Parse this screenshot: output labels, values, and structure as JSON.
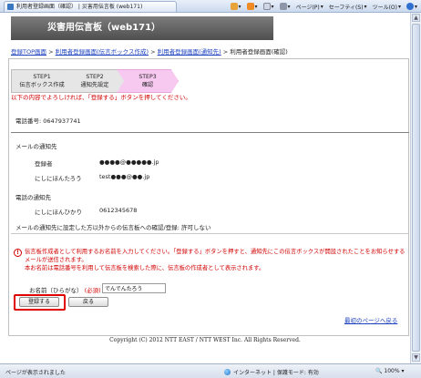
{
  "browser": {
    "tab_title": "利用者登録画面（確認） | 災害用伝言板 (web171)",
    "toolbar": [
      "ページ(P)",
      "セーフティ(S)",
      "ツール(O)"
    ],
    "status_text": "ページが表示されました",
    "zone_text": "インターネット | 保護モード: 有効",
    "zoom": "100%"
  },
  "page": {
    "banner_title": "災害用伝言板（web171）",
    "breadcrumb": [
      {
        "label": "登録TOP画面"
      },
      {
        "label": "利用者登録画面(伝言ボックス作成)"
      },
      {
        "label": "利用者登録画面(通知先)"
      },
      {
        "label": "利用者登録画面(確認)"
      }
    ],
    "steps": [
      {
        "title": "STEP1",
        "sub": "伝言ボックス作成"
      },
      {
        "title": "STEP2",
        "sub": "通知先設定"
      },
      {
        "title": "STEP3",
        "sub": "確認"
      }
    ],
    "instruction": "以下の内容でよろしければ、「登録する」ボタンを押してください。",
    "phone_line": "電話番号: 0647937741",
    "mail_section": "メールの通知先",
    "mail_entries": [
      {
        "name": "登録者",
        "address": "●●●●@●●●●●.jp"
      },
      {
        "name": "にしにほんたろう",
        "address": "test●●●@●●.jp"
      }
    ],
    "phone_section": "電話の通知先",
    "phone_entries": [
      {
        "name": "にしにほんひかり",
        "number": "0612345678"
      }
    ],
    "permission_line": "メールの通知先に設定した方以外からの伝言板への確認/登録: 許可しない",
    "notice_lines": [
      "伝言板作成者として利用するお名前を入力してください。「登録する」ボタンを押すと、通知先にこの伝言ボックスが開設されたことをお知らせするメールが送信されます。",
      "本お名前は電話番号を利用して伝言板を検索した際に、伝言板の作成者として表示されます。"
    ],
    "name_label": "お名前（ひらがな）",
    "required_label": "(必須)",
    "name_value": "でんでんたろう",
    "register_button": "登録する",
    "back_button": "戻る",
    "top_link": "最初のページへ戻る",
    "copyright": "Copyright (C) 2012 NTT EAST / NTT WEST Inc. All Rights Reserved."
  }
}
